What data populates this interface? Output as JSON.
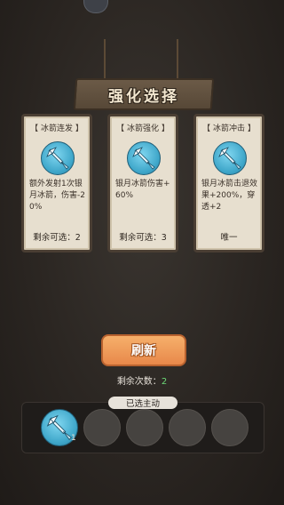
{
  "banner": {
    "title": "强化选择"
  },
  "cards": [
    {
      "title": "【 冰箭连发 】",
      "description": "额外发射1次银月冰箭，伤害-20%",
      "footer": "剩余可选：2",
      "icon": "ice-arrow-icon"
    },
    {
      "title": "【 冰箭强化 】",
      "description": "银月冰箭伤害+60%",
      "footer": "剩余可选：3",
      "icon": "ice-arrow-icon"
    },
    {
      "title": "【 冰箭冲击 】",
      "description": "银月冰箭击退效果+200%，穿透+2",
      "footer": "唯一",
      "icon": "ice-arrow-icon"
    }
  ],
  "refresh": {
    "label": "刷新"
  },
  "remaining": {
    "label": "剩余次数：",
    "count": "2"
  },
  "selected": {
    "tag": "已选主动",
    "slots": [
      {
        "icon": "ice-arrow-icon",
        "level": "1"
      },
      {},
      {},
      {},
      {}
    ]
  },
  "colors": {
    "banner": "#574837",
    "card_bg": "#e7dfcf",
    "refresh": "#e8884a",
    "count": "#6cd977"
  }
}
